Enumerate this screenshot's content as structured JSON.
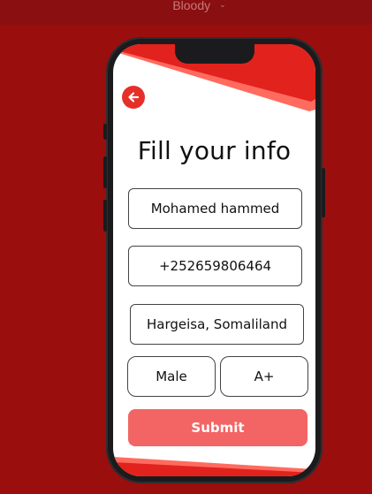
{
  "app": {
    "title": "Bloody"
  },
  "screen": {
    "heading": "Fill your info",
    "fields": {
      "name": "Mohamed hammed",
      "phone": "+252659806464",
      "location": "Hargeisa, Somaliland",
      "gender": "Male",
      "blood_type": "A+"
    },
    "submit_label": "Submit"
  },
  "icons": {
    "back": "arrow-left-icon",
    "title_dropdown": "chevron-down-icon"
  },
  "colors": {
    "background": "#9b0e0e",
    "accent": "#e53029",
    "submit": "#f26564"
  }
}
